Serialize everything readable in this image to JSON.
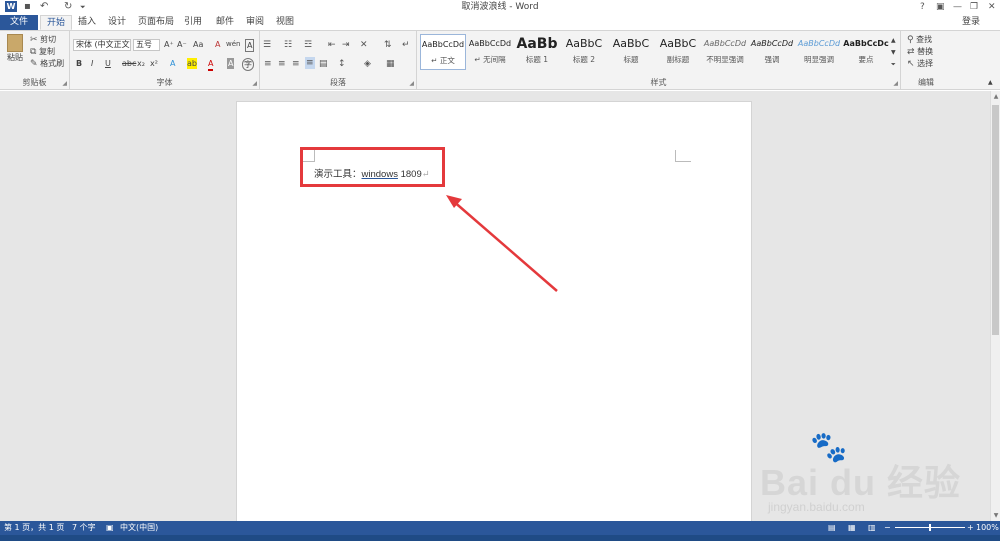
{
  "window": {
    "title": "取消波浪线 - Word",
    "help": "?",
    "ribbon_display": "▣",
    "minimize": "—",
    "restore": "❐",
    "close": "✕"
  },
  "qat": {
    "undo": "↶",
    "redo": "↻",
    "customize": "⏷"
  },
  "tabs": {
    "file": "文件",
    "home": "开始",
    "insert": "插入",
    "design": "设计",
    "layout": "页面布局",
    "references": "引用",
    "mailings": "邮件",
    "review": "审阅",
    "view": "视图",
    "login": "登录"
  },
  "clipboard": {
    "paste": "粘贴",
    "cut": "剪切",
    "copy": "复制",
    "format_painter": "格式刷",
    "label": "剪贴板"
  },
  "font": {
    "family": "宋体 (中文正文",
    "size": "五号",
    "grow": "A⁺",
    "shrink": "A⁻",
    "case": "Aa",
    "clear": "A",
    "phonetic": "wén",
    "border": "A",
    "bold": "B",
    "italic": "I",
    "underline": "U",
    "strike": "abc",
    "sub": "x₂",
    "sup": "x²",
    "effects": "A",
    "highlight": "ab",
    "color": "A",
    "shading": "A",
    "enclose": "字",
    "label": "字体"
  },
  "paragraph": {
    "label": "段落"
  },
  "styles": {
    "label": "样式",
    "items": [
      {
        "sample": "AaBbCcDd",
        "name": "↵ 正文"
      },
      {
        "sample": "AaBbCcDd",
        "name": "↵ 无间隔"
      },
      {
        "sample": "AaBb",
        "name": "标题 1"
      },
      {
        "sample": "AaBbC",
        "name": "标题 2"
      },
      {
        "sample": "AaBbC",
        "name": "标题"
      },
      {
        "sample": "AaBbC",
        "name": "副标题"
      },
      {
        "sample": "AaBbCcDd",
        "name": "不明显强调"
      },
      {
        "sample": "AaBbCcDd",
        "name": "强调"
      },
      {
        "sample": "AaBbCcDd",
        "name": "明显强调"
      },
      {
        "sample": "AaBbCcDc",
        "name": "要点"
      }
    ]
  },
  "editing": {
    "find": "查找",
    "replace": "替换",
    "select": "选择",
    "label": "编辑"
  },
  "document": {
    "prefix": "演示工具：",
    "word": "windows",
    "num": " 1809",
    "pilcrow": "↵"
  },
  "status": {
    "page": "第 1 页，共 1 页",
    "words": "7 个字",
    "language": "中文(中国)",
    "zoom": "100%",
    "zoom_minus": "−",
    "zoom_plus": "+"
  },
  "watermark": {
    "brand": "Bai du 经验",
    "url": "jingyan.baidu.com"
  },
  "colors": {
    "accent": "#2b579a",
    "highlight_box": "#e4393c"
  }
}
